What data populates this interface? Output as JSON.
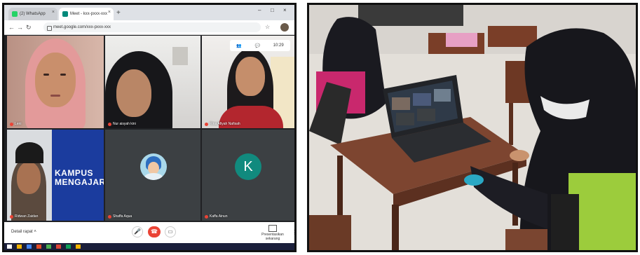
{
  "browser": {
    "tabs": [
      {
        "label": "(2) WhatsApp",
        "favicon_color": "#25d366"
      },
      {
        "label": "Meet - kxx-pxxx-xxx",
        "favicon_color": "#00897b"
      }
    ],
    "new_tab_symbol": "+",
    "window_controls": [
      "–",
      "□",
      "×"
    ],
    "url": "meet.google.com/xxx-pxxx-xxx",
    "overlay_time": "10:29"
  },
  "meet": {
    "participants": [
      {
        "name": "Leni"
      },
      {
        "name": "Nur aisyah kini"
      },
      {
        "name": "Rina Afiyah Nafisah"
      },
      {
        "name": "Ridwan Zaidan"
      },
      {
        "name": "Shaffa Aqua"
      },
      {
        "name": "Kaffa Ainun",
        "initial": "K",
        "avatar_color": "#118a7e"
      }
    ],
    "banner_lines": [
      "KAMPUS",
      "MENGAJAR"
    ],
    "details_label": "Detail rapat",
    "present_label": "Presentasikan sekarang",
    "colors": {
      "end_call": "#ea4335",
      "background": "#202124"
    }
  },
  "taskbar": {
    "icon_colors": [
      "#ffffff",
      "#f4b400",
      "#4285f4",
      "#e34c26",
      "#4caf50",
      "#db4437",
      "#0f9d58",
      "#f4b400"
    ]
  }
}
